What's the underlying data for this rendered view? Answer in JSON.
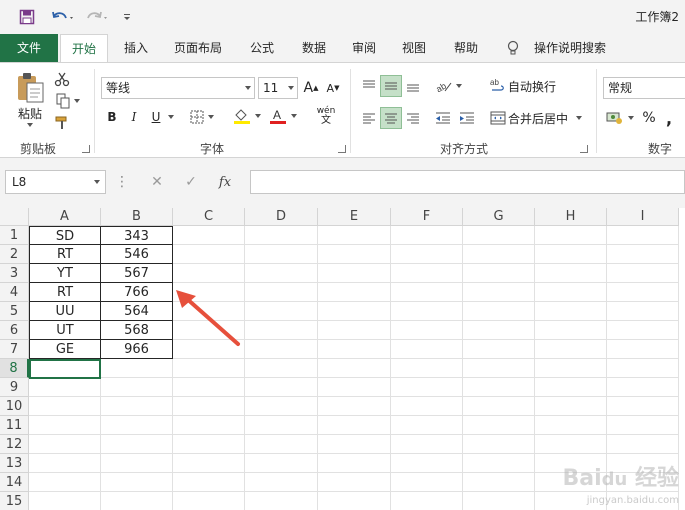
{
  "window": {
    "title": "工作簿2"
  },
  "tabs": [
    {
      "label": "文件"
    },
    {
      "label": "开始"
    },
    {
      "label": "插入"
    },
    {
      "label": "页面布局"
    },
    {
      "label": "公式"
    },
    {
      "label": "数据"
    },
    {
      "label": "审阅"
    },
    {
      "label": "视图"
    },
    {
      "label": "帮助"
    },
    {
      "label": "操作说明搜索"
    }
  ],
  "ribbon": {
    "clipboard": {
      "paste_label": "粘贴",
      "group_label": "剪贴板"
    },
    "font": {
      "font_name": "等线",
      "font_size": "11",
      "group_label": "字体",
      "bold": "B",
      "italic": "I",
      "underline": "U",
      "wen": "wén",
      "wen2": "文"
    },
    "alignment": {
      "wrap_label": "自动换行",
      "merge_label": "合并后居中",
      "group_label": "对齐方式"
    },
    "number": {
      "format": "常规",
      "group_label": "数字",
      "percent": "%",
      "comma": ","
    }
  },
  "formula_bar": {
    "name_box": "L8",
    "fx": "fx",
    "formula": ""
  },
  "sheet": {
    "columns": [
      "A",
      "B",
      "C",
      "D",
      "E",
      "F",
      "G",
      "H",
      "I"
    ],
    "rows": [
      "1",
      "2",
      "3",
      "4",
      "5",
      "6",
      "7",
      "8",
      "9",
      "10",
      "11",
      "12",
      "13",
      "14",
      "15"
    ],
    "data": [
      [
        "SD",
        "343"
      ],
      [
        "RT",
        "546"
      ],
      [
        "YT",
        "567"
      ],
      [
        "RT",
        "766"
      ],
      [
        "UU",
        "564"
      ],
      [
        "UT",
        "568"
      ],
      [
        "GE",
        "966"
      ]
    ],
    "active_row": "8"
  },
  "colors": {
    "accent": "#217346",
    "arrow": "#e6503c"
  }
}
